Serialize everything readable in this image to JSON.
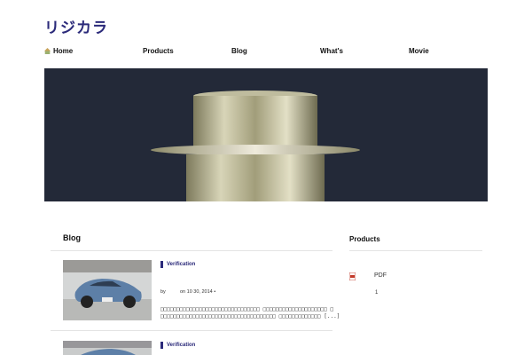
{
  "site": {
    "logo_text": "リジカラ"
  },
  "nav": {
    "items": [
      {
        "label": "Home"
      },
      {
        "label": "Products"
      },
      {
        "label": "Blog"
      },
      {
        "label": "What's"
      },
      {
        "label": "Movie"
      }
    ]
  },
  "main": {
    "heading": "Blog",
    "posts": [
      {
        "category": "Verification",
        "by": "by",
        "date": "on 10  30, 2014 •",
        "excerpt_line1": "□□□□□□□□□□□□□□□□□□□□□□□□□□□□□□□ □□□□□□□□□□□□□□□□□□□□ □",
        "excerpt_line2": "□□□□□□□□□□□□□□□□□□□□□□□□□□□□□□□□□□□□ □□□□□□□□□□□□□ [...]"
      },
      {
        "category": "Verification"
      }
    ]
  },
  "sidebar": {
    "heading": "Products",
    "pdf_label": "PDF",
    "count": "1"
  },
  "colors": {
    "brand": "#2b2a7a",
    "hero_bg": "#222836"
  }
}
